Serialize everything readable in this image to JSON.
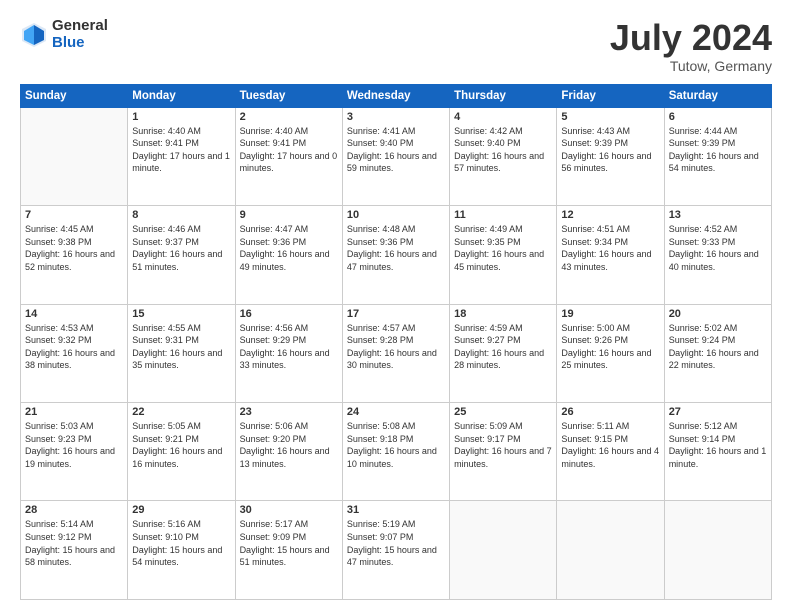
{
  "header": {
    "logo_general": "General",
    "logo_blue": "Blue",
    "month": "July 2024",
    "location": "Tutow, Germany"
  },
  "weekdays": [
    "Sunday",
    "Monday",
    "Tuesday",
    "Wednesday",
    "Thursday",
    "Friday",
    "Saturday"
  ],
  "weeks": [
    [
      {
        "day": "",
        "sunrise": "",
        "sunset": "",
        "daylight": ""
      },
      {
        "day": "1",
        "sunrise": "Sunrise: 4:40 AM",
        "sunset": "Sunset: 9:41 PM",
        "daylight": "Daylight: 17 hours and 1 minute."
      },
      {
        "day": "2",
        "sunrise": "Sunrise: 4:40 AM",
        "sunset": "Sunset: 9:41 PM",
        "daylight": "Daylight: 17 hours and 0 minutes."
      },
      {
        "day": "3",
        "sunrise": "Sunrise: 4:41 AM",
        "sunset": "Sunset: 9:40 PM",
        "daylight": "Daylight: 16 hours and 59 minutes."
      },
      {
        "day": "4",
        "sunrise": "Sunrise: 4:42 AM",
        "sunset": "Sunset: 9:40 PM",
        "daylight": "Daylight: 16 hours and 57 minutes."
      },
      {
        "day": "5",
        "sunrise": "Sunrise: 4:43 AM",
        "sunset": "Sunset: 9:39 PM",
        "daylight": "Daylight: 16 hours and 56 minutes."
      },
      {
        "day": "6",
        "sunrise": "Sunrise: 4:44 AM",
        "sunset": "Sunset: 9:39 PM",
        "daylight": "Daylight: 16 hours and 54 minutes."
      }
    ],
    [
      {
        "day": "7",
        "sunrise": "Sunrise: 4:45 AM",
        "sunset": "Sunset: 9:38 PM",
        "daylight": "Daylight: 16 hours and 52 minutes."
      },
      {
        "day": "8",
        "sunrise": "Sunrise: 4:46 AM",
        "sunset": "Sunset: 9:37 PM",
        "daylight": "Daylight: 16 hours and 51 minutes."
      },
      {
        "day": "9",
        "sunrise": "Sunrise: 4:47 AM",
        "sunset": "Sunset: 9:36 PM",
        "daylight": "Daylight: 16 hours and 49 minutes."
      },
      {
        "day": "10",
        "sunrise": "Sunrise: 4:48 AM",
        "sunset": "Sunset: 9:36 PM",
        "daylight": "Daylight: 16 hours and 47 minutes."
      },
      {
        "day": "11",
        "sunrise": "Sunrise: 4:49 AM",
        "sunset": "Sunset: 9:35 PM",
        "daylight": "Daylight: 16 hours and 45 minutes."
      },
      {
        "day": "12",
        "sunrise": "Sunrise: 4:51 AM",
        "sunset": "Sunset: 9:34 PM",
        "daylight": "Daylight: 16 hours and 43 minutes."
      },
      {
        "day": "13",
        "sunrise": "Sunrise: 4:52 AM",
        "sunset": "Sunset: 9:33 PM",
        "daylight": "Daylight: 16 hours and 40 minutes."
      }
    ],
    [
      {
        "day": "14",
        "sunrise": "Sunrise: 4:53 AM",
        "sunset": "Sunset: 9:32 PM",
        "daylight": "Daylight: 16 hours and 38 minutes."
      },
      {
        "day": "15",
        "sunrise": "Sunrise: 4:55 AM",
        "sunset": "Sunset: 9:31 PM",
        "daylight": "Daylight: 16 hours and 35 minutes."
      },
      {
        "day": "16",
        "sunrise": "Sunrise: 4:56 AM",
        "sunset": "Sunset: 9:29 PM",
        "daylight": "Daylight: 16 hours and 33 minutes."
      },
      {
        "day": "17",
        "sunrise": "Sunrise: 4:57 AM",
        "sunset": "Sunset: 9:28 PM",
        "daylight": "Daylight: 16 hours and 30 minutes."
      },
      {
        "day": "18",
        "sunrise": "Sunrise: 4:59 AM",
        "sunset": "Sunset: 9:27 PM",
        "daylight": "Daylight: 16 hours and 28 minutes."
      },
      {
        "day": "19",
        "sunrise": "Sunrise: 5:00 AM",
        "sunset": "Sunset: 9:26 PM",
        "daylight": "Daylight: 16 hours and 25 minutes."
      },
      {
        "day": "20",
        "sunrise": "Sunrise: 5:02 AM",
        "sunset": "Sunset: 9:24 PM",
        "daylight": "Daylight: 16 hours and 22 minutes."
      }
    ],
    [
      {
        "day": "21",
        "sunrise": "Sunrise: 5:03 AM",
        "sunset": "Sunset: 9:23 PM",
        "daylight": "Daylight: 16 hours and 19 minutes."
      },
      {
        "day": "22",
        "sunrise": "Sunrise: 5:05 AM",
        "sunset": "Sunset: 9:21 PM",
        "daylight": "Daylight: 16 hours and 16 minutes."
      },
      {
        "day": "23",
        "sunrise": "Sunrise: 5:06 AM",
        "sunset": "Sunset: 9:20 PM",
        "daylight": "Daylight: 16 hours and 13 minutes."
      },
      {
        "day": "24",
        "sunrise": "Sunrise: 5:08 AM",
        "sunset": "Sunset: 9:18 PM",
        "daylight": "Daylight: 16 hours and 10 minutes."
      },
      {
        "day": "25",
        "sunrise": "Sunrise: 5:09 AM",
        "sunset": "Sunset: 9:17 PM",
        "daylight": "Daylight: 16 hours and 7 minutes."
      },
      {
        "day": "26",
        "sunrise": "Sunrise: 5:11 AM",
        "sunset": "Sunset: 9:15 PM",
        "daylight": "Daylight: 16 hours and 4 minutes."
      },
      {
        "day": "27",
        "sunrise": "Sunrise: 5:12 AM",
        "sunset": "Sunset: 9:14 PM",
        "daylight": "Daylight: 16 hours and 1 minute."
      }
    ],
    [
      {
        "day": "28",
        "sunrise": "Sunrise: 5:14 AM",
        "sunset": "Sunset: 9:12 PM",
        "daylight": "Daylight: 15 hours and 58 minutes."
      },
      {
        "day": "29",
        "sunrise": "Sunrise: 5:16 AM",
        "sunset": "Sunset: 9:10 PM",
        "daylight": "Daylight: 15 hours and 54 minutes."
      },
      {
        "day": "30",
        "sunrise": "Sunrise: 5:17 AM",
        "sunset": "Sunset: 9:09 PM",
        "daylight": "Daylight: 15 hours and 51 minutes."
      },
      {
        "day": "31",
        "sunrise": "Sunrise: 5:19 AM",
        "sunset": "Sunset: 9:07 PM",
        "daylight": "Daylight: 15 hours and 47 minutes."
      },
      {
        "day": "",
        "sunrise": "",
        "sunset": "",
        "daylight": ""
      },
      {
        "day": "",
        "sunrise": "",
        "sunset": "",
        "daylight": ""
      },
      {
        "day": "",
        "sunrise": "",
        "sunset": "",
        "daylight": ""
      }
    ]
  ]
}
